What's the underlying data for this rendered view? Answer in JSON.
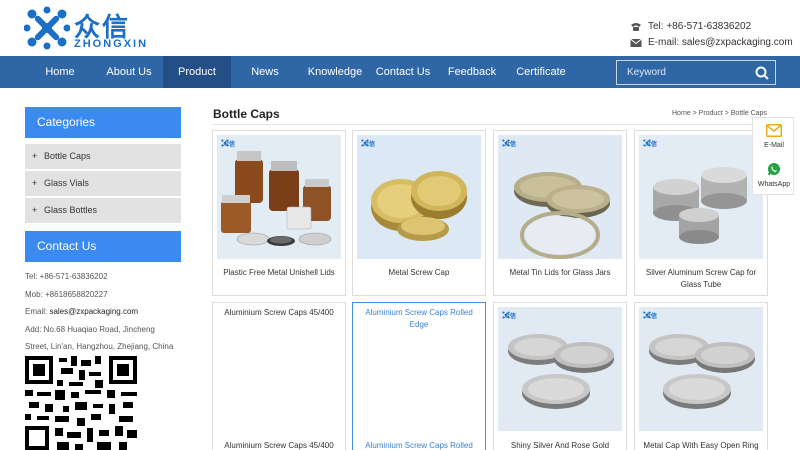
{
  "brand": {
    "cn": "众信",
    "en": "ZHONGXIN",
    "color": "#1b6fc4"
  },
  "header": {
    "tel": "Tel: +86-571-63836202",
    "email": "E-mail: sales@zxpackaging.com"
  },
  "nav": {
    "items": [
      "Home",
      "About Us",
      "Product",
      "News",
      "Knowledge",
      "Contact Us",
      "Feedback",
      "Certificate"
    ],
    "active": "Product",
    "search_placeholder": "Keyword"
  },
  "sidebar": {
    "categories_title": "Categories",
    "categories": [
      "Bottle Caps",
      "Glass Vials",
      "Glass Bottles"
    ],
    "contact_title": "Contact Us",
    "tel": "Tel: +86-571-63836202",
    "mob": "Mob: +8618658820227",
    "email_label": "Email: ",
    "email": "sales@zxpackaging.com",
    "address_1": "Add: No.68 Huaqiao Road, Jincheng",
    "address_2": "Street, Lin'an, Hangzhou, Zhejiang, China"
  },
  "main": {
    "title": "Bottle Caps",
    "breadcrumb": "Home > Product > Bottle Caps",
    "badge": "众信",
    "products": [
      {
        "name": "Plastic Free Metal Unishell Lids",
        "icon": "amber-jars-with-tins"
      },
      {
        "name": "Metal Screw Cap",
        "icon": "gold-screw-caps"
      },
      {
        "name": "Metal Tin Lids for Glass Jars",
        "icon": "tin-lids"
      },
      {
        "name": "Silver Aluminum Screw Cap for Glass Tube",
        "icon": "silver-screw-caps"
      },
      {
        "name": "Aluminium Screw Caps 45/400",
        "icon": "blank"
      },
      {
        "name": "Aluminium Screw Caps Rolled Edge",
        "icon": "blank"
      },
      {
        "name": "Shiny Silver And Rose Gold",
        "icon": "silver-tins"
      },
      {
        "name": "Metal Cap With Easy Open Ring",
        "icon": "silver-tins"
      }
    ],
    "captions_bottom": [
      "Aluminium Screw Caps 45/400",
      "Aluminium Screw Caps Rolled"
    ]
  },
  "float": {
    "email": "E-Mail",
    "whatsapp": "WhatsApp"
  },
  "colors": {
    "nav": "#2f66a6",
    "nav_active": "#234f86",
    "side_head": "#3b8af0",
    "accent": "#3b82d6"
  }
}
